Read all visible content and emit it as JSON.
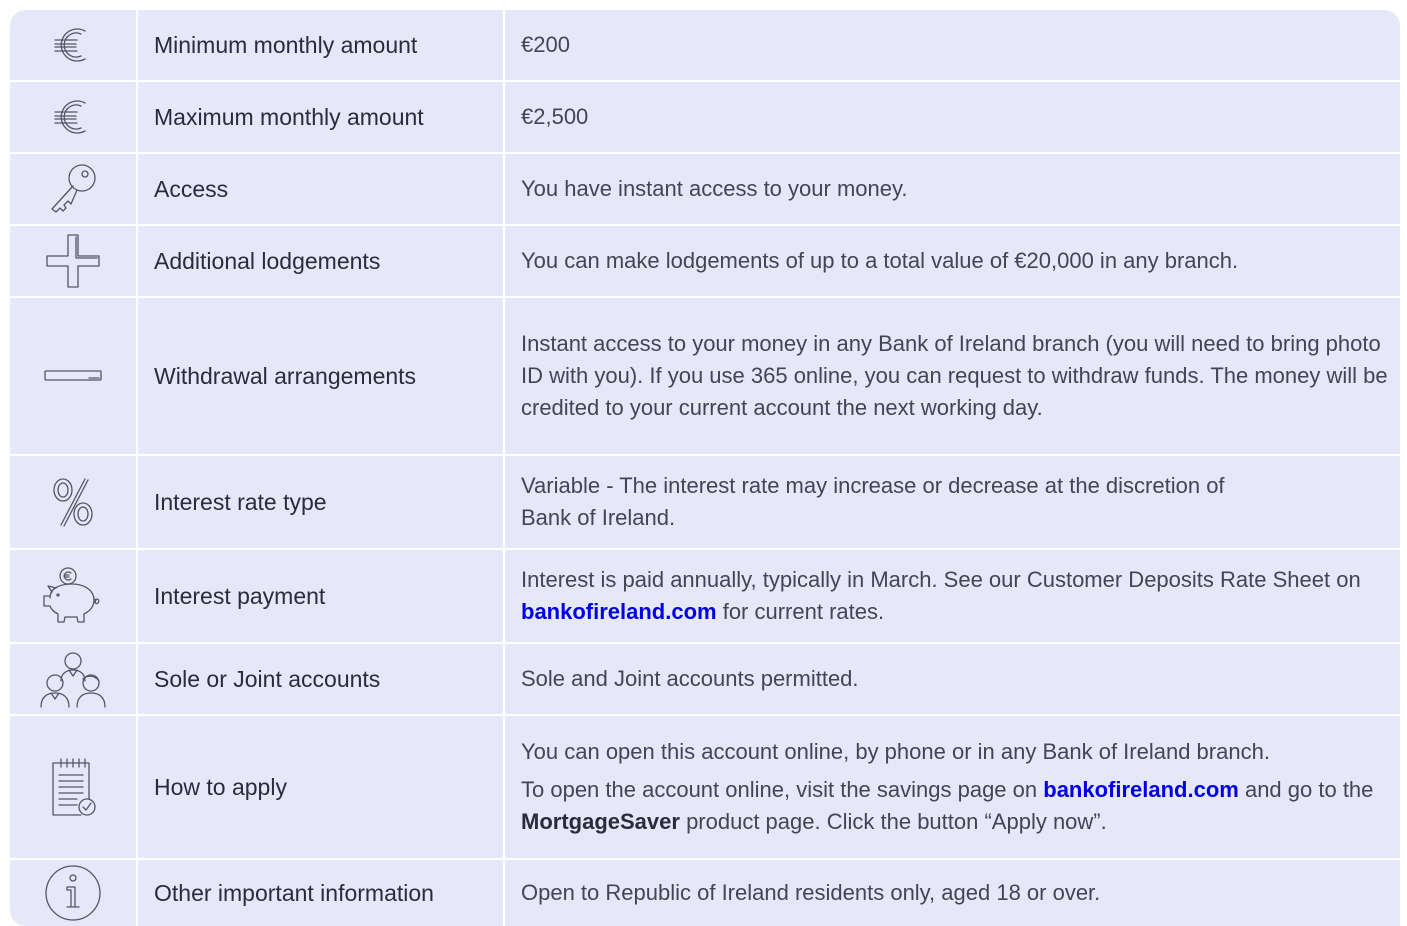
{
  "rows": [
    {
      "icon": "euro-icon",
      "label": "Minimum monthly amount",
      "value": "€200"
    },
    {
      "icon": "euro-icon",
      "label": "Maximum monthly amount",
      "value": "€2,500"
    },
    {
      "icon": "key-icon",
      "label": "Access",
      "value": "You have instant access to your money."
    },
    {
      "icon": "plus-icon",
      "label": "Additional lodgements",
      "value": "You can make lodgements of up to a total value of €20,000 in any branch."
    },
    {
      "icon": "minus-icon",
      "label": "Withdrawal arrangements",
      "value": "Instant access to your money in any Bank of Ireland branch (you will need to bring photo ID with you). If you use 365 online, you can request to withdraw funds. The money will be credited to your current account the next working day."
    },
    {
      "icon": "percent-icon",
      "label": "Interest rate type",
      "value_line1": "Variable - The interest rate may increase or decrease at the discretion of",
      "value_line2": "Bank of Ireland."
    },
    {
      "icon": "piggy-bank-icon",
      "label": "Interest payment",
      "value_pre": "Interest is paid annually, typically in March. See our Customer Deposits Rate Sheet on ",
      "value_link": "bankofireland.com",
      "value_post": " for current rates."
    },
    {
      "icon": "people-icon",
      "label": "Sole or Joint accounts",
      "value": "Sole and Joint accounts permitted."
    },
    {
      "icon": "notepad-check-icon",
      "label": "How to apply",
      "value_p1": "You can open this account online, by phone or in any Bank of Ireland branch.",
      "value_p2_pre": "To open the account online, visit the savings page on ",
      "value_p2_link": "bankofireland.com",
      "value_p2_mid": " and go to the ",
      "value_p2_bold": "MortgageSaver",
      "value_p2_post": " product page. Click the button “Apply now”."
    },
    {
      "icon": "info-icon",
      "label": "Other important information",
      "value": "Open to Republic of Ireland residents only, aged 18 or over."
    }
  ],
  "colors": {
    "background": "#e6e7f8",
    "link": "#0000e6",
    "divider": "#ffffff"
  }
}
